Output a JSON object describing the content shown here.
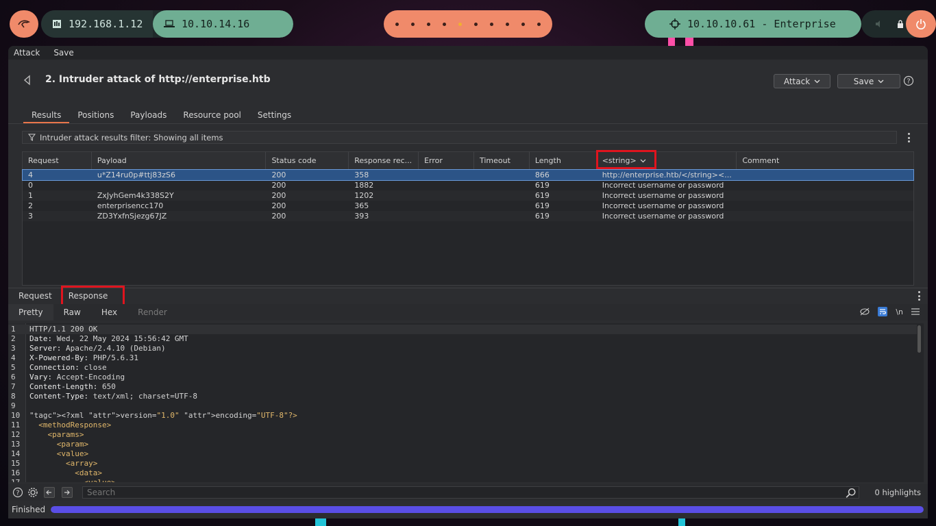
{
  "topbar": {
    "local_ip": "192.168.1.12",
    "vpn_ip": "10.10.14.16",
    "workspaces": [
      1,
      2,
      3,
      4,
      5,
      6,
      7,
      8,
      9,
      10
    ],
    "active_workspace": 5,
    "target": "10.10.10.61 - Enterprise"
  },
  "menu": {
    "attack": "Attack",
    "save": "Save"
  },
  "header": {
    "title": "2. Intruder attack of http://enterprise.htb",
    "attack_btn": "Attack",
    "save_btn": "Save"
  },
  "tabs": [
    "Results",
    "Positions",
    "Payloads",
    "Resource pool",
    "Settings"
  ],
  "filter": {
    "text": "Intruder attack results filter: Showing all items"
  },
  "table": {
    "headers": [
      "Request",
      "Payload",
      "Status code",
      "Response rec...",
      "Error",
      "Timeout",
      "Length",
      "<string>",
      "Comment"
    ],
    "rows": [
      [
        "4",
        "u*Z14ru0p#ttj83zS6",
        "200",
        "358",
        "",
        "",
        "866",
        "http://enterprise.htb/</string><...",
        ""
      ],
      [
        "0",
        "",
        "200",
        "1882",
        "",
        "",
        "619",
        "Incorrect username or password",
        ""
      ],
      [
        "1",
        "ZxJyhGem4k338S2Y",
        "200",
        "1202",
        "",
        "",
        "619",
        "Incorrect username or password",
        ""
      ],
      [
        "2",
        "enterprisencc170",
        "200",
        "365",
        "",
        "",
        "619",
        "Incorrect username or password",
        ""
      ],
      [
        "3",
        "ZD3YxfnSjezg67JZ",
        "200",
        "393",
        "",
        "",
        "619",
        "Incorrect username or password",
        ""
      ]
    ]
  },
  "rr_tabs": {
    "request": "Request",
    "response": "Response"
  },
  "sub_tabs": {
    "pretty": "Pretty",
    "raw": "Raw",
    "hex": "Hex",
    "render": "Render",
    "newline": "\\n"
  },
  "code_lines": [
    "HTTP/1.1 200 OK",
    "Date: Wed, 22 May 2024 15:56:42 GMT",
    "Server: Apache/2.4.10 (Debian)",
    "X-Powered-By: PHP/5.6.31",
    "Connection: close",
    "Vary: Accept-Encoding",
    "Content-Length: 650",
    "Content-Type: text/xml; charset=UTF-8",
    "",
    "<?xml version=\"1.0\" encoding=\"UTF-8\"?>",
    "  <methodResponse>",
    "    <params>",
    "      <param>",
    "      <value>",
    "        <array>",
    "          <data>",
    "            <value>"
  ],
  "search": {
    "placeholder": "Search",
    "highlights": "0 highlights"
  },
  "status": {
    "text": "Finished",
    "progress": 1.0
  }
}
